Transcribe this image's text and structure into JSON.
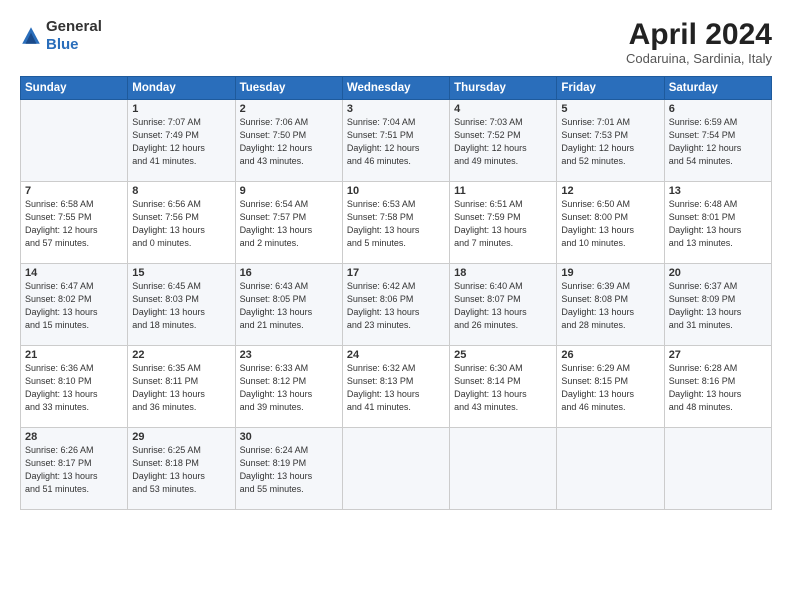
{
  "header": {
    "logo_line1": "General",
    "logo_line2": "Blue",
    "month_title": "April 2024",
    "location": "Codaruina, Sardinia, Italy"
  },
  "days_of_week": [
    "Sunday",
    "Monday",
    "Tuesday",
    "Wednesday",
    "Thursday",
    "Friday",
    "Saturday"
  ],
  "weeks": [
    [
      {
        "day": "",
        "info": ""
      },
      {
        "day": "1",
        "info": "Sunrise: 7:07 AM\nSunset: 7:49 PM\nDaylight: 12 hours\nand 41 minutes."
      },
      {
        "day": "2",
        "info": "Sunrise: 7:06 AM\nSunset: 7:50 PM\nDaylight: 12 hours\nand 43 minutes."
      },
      {
        "day": "3",
        "info": "Sunrise: 7:04 AM\nSunset: 7:51 PM\nDaylight: 12 hours\nand 46 minutes."
      },
      {
        "day": "4",
        "info": "Sunrise: 7:03 AM\nSunset: 7:52 PM\nDaylight: 12 hours\nand 49 minutes."
      },
      {
        "day": "5",
        "info": "Sunrise: 7:01 AM\nSunset: 7:53 PM\nDaylight: 12 hours\nand 52 minutes."
      },
      {
        "day": "6",
        "info": "Sunrise: 6:59 AM\nSunset: 7:54 PM\nDaylight: 12 hours\nand 54 minutes."
      }
    ],
    [
      {
        "day": "7",
        "info": "Sunrise: 6:58 AM\nSunset: 7:55 PM\nDaylight: 12 hours\nand 57 minutes."
      },
      {
        "day": "8",
        "info": "Sunrise: 6:56 AM\nSunset: 7:56 PM\nDaylight: 13 hours\nand 0 minutes."
      },
      {
        "day": "9",
        "info": "Sunrise: 6:54 AM\nSunset: 7:57 PM\nDaylight: 13 hours\nand 2 minutes."
      },
      {
        "day": "10",
        "info": "Sunrise: 6:53 AM\nSunset: 7:58 PM\nDaylight: 13 hours\nand 5 minutes."
      },
      {
        "day": "11",
        "info": "Sunrise: 6:51 AM\nSunset: 7:59 PM\nDaylight: 13 hours\nand 7 minutes."
      },
      {
        "day": "12",
        "info": "Sunrise: 6:50 AM\nSunset: 8:00 PM\nDaylight: 13 hours\nand 10 minutes."
      },
      {
        "day": "13",
        "info": "Sunrise: 6:48 AM\nSunset: 8:01 PM\nDaylight: 13 hours\nand 13 minutes."
      }
    ],
    [
      {
        "day": "14",
        "info": "Sunrise: 6:47 AM\nSunset: 8:02 PM\nDaylight: 13 hours\nand 15 minutes."
      },
      {
        "day": "15",
        "info": "Sunrise: 6:45 AM\nSunset: 8:03 PM\nDaylight: 13 hours\nand 18 minutes."
      },
      {
        "day": "16",
        "info": "Sunrise: 6:43 AM\nSunset: 8:05 PM\nDaylight: 13 hours\nand 21 minutes."
      },
      {
        "day": "17",
        "info": "Sunrise: 6:42 AM\nSunset: 8:06 PM\nDaylight: 13 hours\nand 23 minutes."
      },
      {
        "day": "18",
        "info": "Sunrise: 6:40 AM\nSunset: 8:07 PM\nDaylight: 13 hours\nand 26 minutes."
      },
      {
        "day": "19",
        "info": "Sunrise: 6:39 AM\nSunset: 8:08 PM\nDaylight: 13 hours\nand 28 minutes."
      },
      {
        "day": "20",
        "info": "Sunrise: 6:37 AM\nSunset: 8:09 PM\nDaylight: 13 hours\nand 31 minutes."
      }
    ],
    [
      {
        "day": "21",
        "info": "Sunrise: 6:36 AM\nSunset: 8:10 PM\nDaylight: 13 hours\nand 33 minutes."
      },
      {
        "day": "22",
        "info": "Sunrise: 6:35 AM\nSunset: 8:11 PM\nDaylight: 13 hours\nand 36 minutes."
      },
      {
        "day": "23",
        "info": "Sunrise: 6:33 AM\nSunset: 8:12 PM\nDaylight: 13 hours\nand 39 minutes."
      },
      {
        "day": "24",
        "info": "Sunrise: 6:32 AM\nSunset: 8:13 PM\nDaylight: 13 hours\nand 41 minutes."
      },
      {
        "day": "25",
        "info": "Sunrise: 6:30 AM\nSunset: 8:14 PM\nDaylight: 13 hours\nand 43 minutes."
      },
      {
        "day": "26",
        "info": "Sunrise: 6:29 AM\nSunset: 8:15 PM\nDaylight: 13 hours\nand 46 minutes."
      },
      {
        "day": "27",
        "info": "Sunrise: 6:28 AM\nSunset: 8:16 PM\nDaylight: 13 hours\nand 48 minutes."
      }
    ],
    [
      {
        "day": "28",
        "info": "Sunrise: 6:26 AM\nSunset: 8:17 PM\nDaylight: 13 hours\nand 51 minutes."
      },
      {
        "day": "29",
        "info": "Sunrise: 6:25 AM\nSunset: 8:18 PM\nDaylight: 13 hours\nand 53 minutes."
      },
      {
        "day": "30",
        "info": "Sunrise: 6:24 AM\nSunset: 8:19 PM\nDaylight: 13 hours\nand 55 minutes."
      },
      {
        "day": "",
        "info": ""
      },
      {
        "day": "",
        "info": ""
      },
      {
        "day": "",
        "info": ""
      },
      {
        "day": "",
        "info": ""
      }
    ]
  ]
}
